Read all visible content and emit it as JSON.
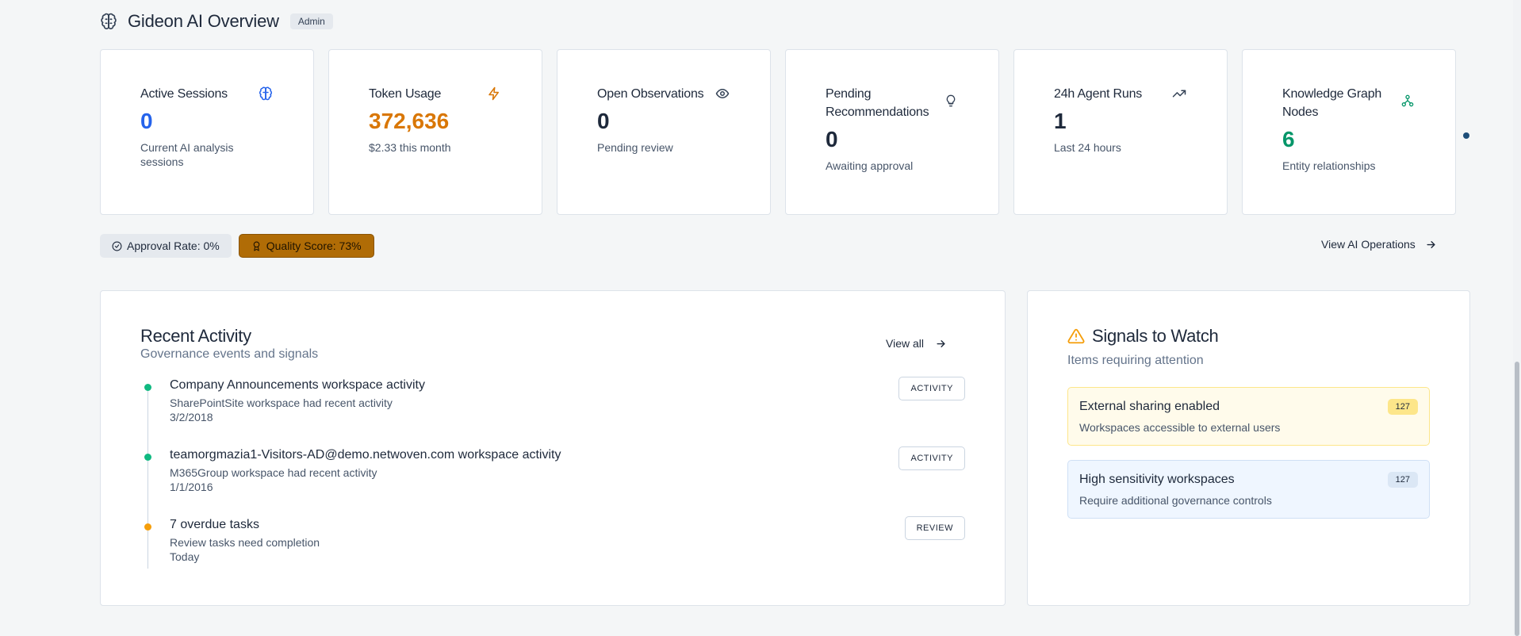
{
  "header": {
    "title": "Gideon AI Overview",
    "badge": "Admin",
    "icon": "brain-icon"
  },
  "stats": [
    {
      "label": "Active Sessions",
      "value": "0",
      "sub": "Current AI analysis sessions",
      "icon": "brain-icon",
      "color": "#2563eb"
    },
    {
      "label": "Token Usage",
      "value": "372,636",
      "sub": "$2.33 this month",
      "icon": "lightning-icon",
      "color": "#d97706"
    },
    {
      "label": "Open Observations",
      "value": "0",
      "sub": "Pending review",
      "icon": "eye-icon",
      "color": "#1e293b"
    },
    {
      "label": "Pending Recommendations",
      "value": "0",
      "sub": "Awaiting approval",
      "icon": "lightbulb-icon",
      "color": "#1e293b"
    },
    {
      "label": "24h Agent Runs",
      "value": "1",
      "sub": "Last 24 hours",
      "icon": "trending-up-icon",
      "color": "#1e293b"
    },
    {
      "label": "Knowledge Graph Nodes",
      "value": "6",
      "sub": "Entity relationships",
      "icon": "network-icon",
      "color": "#059669"
    }
  ],
  "pills": {
    "approval_rate": "Approval Rate: 0%",
    "quality_score": "Quality Score: 73%"
  },
  "view_ops_label": "View AI Operations",
  "activity": {
    "title": "Recent Activity",
    "subtitle": "Governance events and signals",
    "view_all": "View all",
    "items": [
      {
        "title": "Company Announcements workspace activity",
        "desc": "SharePointSite workspace had recent activity",
        "date": "3/2/2018",
        "tag": "ACTIVITY",
        "status": "green"
      },
      {
        "title": "teamorgmazia1-Visitors-AD@demo.netwoven.com workspace activity",
        "desc": "M365Group workspace had recent activity",
        "date": "1/1/2016",
        "tag": "ACTIVITY",
        "status": "green"
      },
      {
        "title": "7 overdue tasks",
        "desc": "Review tasks need completion",
        "date": "Today",
        "tag": "REVIEW",
        "status": "orange"
      }
    ]
  },
  "signals": {
    "title": "Signals to Watch",
    "subtitle": "Items requiring attention",
    "items": [
      {
        "title": "External sharing enabled",
        "desc": "Workspaces accessible to external users",
        "count": "127"
      },
      {
        "title": "High sensitivity workspaces",
        "desc": "Require additional governance controls",
        "count": "127"
      }
    ]
  }
}
